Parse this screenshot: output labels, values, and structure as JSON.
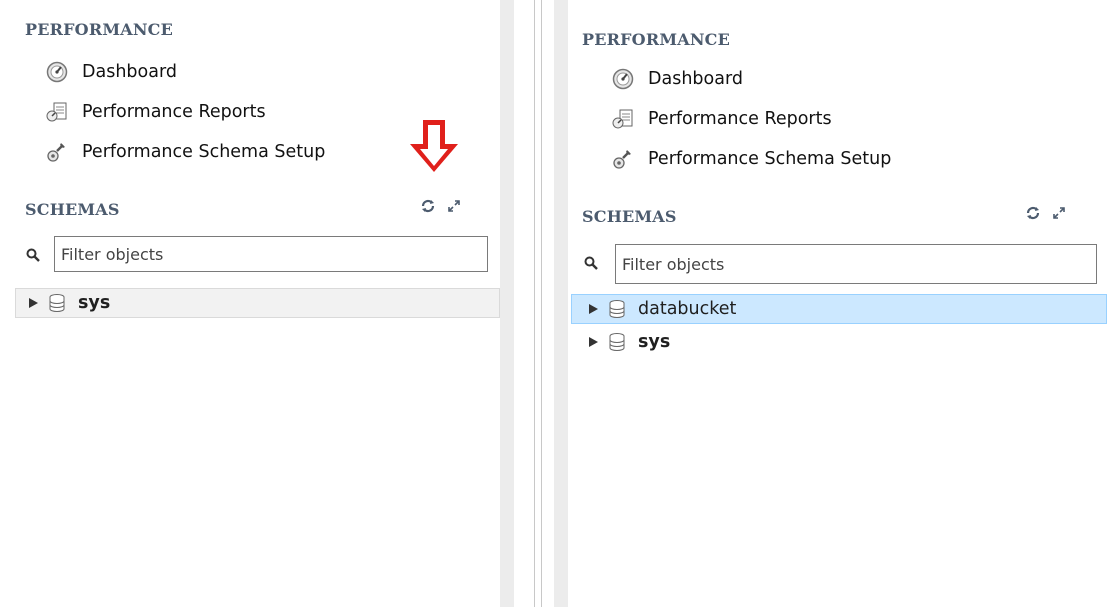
{
  "left": {
    "performance_title": "PERFORMANCE",
    "nav": [
      {
        "label": "Dashboard",
        "icon": "dashboard-gauge-icon"
      },
      {
        "label": "Performance Reports",
        "icon": "performance-reports-icon"
      },
      {
        "label": "Performance Schema Setup",
        "icon": "schema-setup-wrench-icon"
      }
    ],
    "schemas_title": "SCHEMAS",
    "filter_placeholder": "Filter objects",
    "schemas": [
      {
        "name": "sys",
        "bold": true,
        "selected": false
      }
    ]
  },
  "right": {
    "performance_title": "PERFORMANCE",
    "nav": [
      {
        "label": "Dashboard",
        "icon": "dashboard-gauge-icon"
      },
      {
        "label": "Performance Reports",
        "icon": "performance-reports-icon"
      },
      {
        "label": "Performance Schema Setup",
        "icon": "schema-setup-wrench-icon"
      }
    ],
    "schemas_title": "SCHEMAS",
    "filter_placeholder": "Filter objects",
    "schemas": [
      {
        "name": "databucket",
        "bold": false,
        "selected": true
      },
      {
        "name": "sys",
        "bold": true,
        "selected": false
      }
    ]
  },
  "annotation": {
    "arrow_icon": "red-down-arrow-icon",
    "arrow_color": "#e0201b"
  },
  "colors": {
    "section_title": "#4c5b6e",
    "selected_row_bg": "#cce8ff",
    "selected_row_border": "#99d1ff",
    "left_row_bg": "#f2f2f2"
  }
}
